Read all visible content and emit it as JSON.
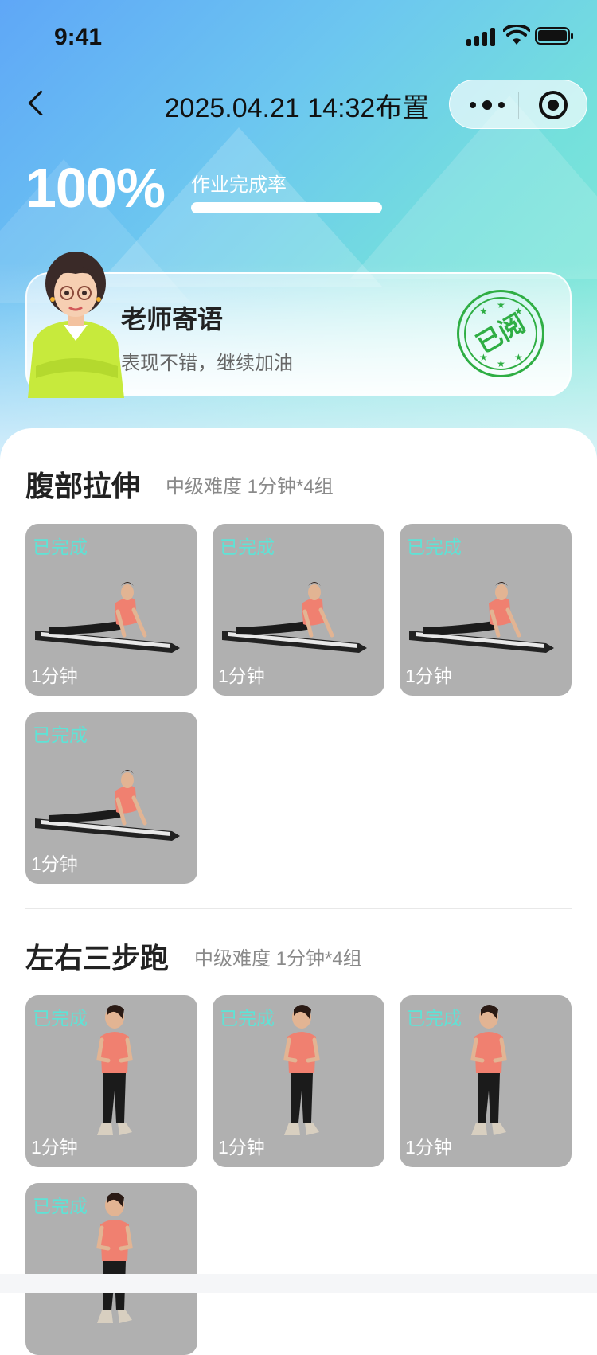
{
  "status": {
    "time": "9:41"
  },
  "nav": {
    "title": "2025.04.21 14:32布置"
  },
  "completion": {
    "rate_text": "100%",
    "label": "作业完成率",
    "fraction": 1.0
  },
  "teacher_note": {
    "title": "老师寄语",
    "message": "表现不错，继续加油",
    "stamp": "已阅"
  },
  "sections": [
    {
      "title": "腹部拉伸",
      "meta": "中级难度 1分钟*4组",
      "items": [
        {
          "status": "已完成",
          "duration": "1分钟"
        },
        {
          "status": "已完成",
          "duration": "1分钟"
        },
        {
          "status": "已完成",
          "duration": "1分钟"
        },
        {
          "status": "已完成",
          "duration": "1分钟"
        }
      ]
    },
    {
      "title": "左右三步跑",
      "meta": "中级难度 1分钟*4组",
      "items": [
        {
          "status": "已完成",
          "duration": "1分钟"
        },
        {
          "status": "已完成",
          "duration": "1分钟"
        },
        {
          "status": "已完成",
          "duration": "1分钟"
        },
        {
          "status": "已完成",
          "duration": ""
        }
      ]
    }
  ],
  "colors": {
    "done": "#5ee3d6",
    "stamp": "#2fae44",
    "tile_bg": "#b0b0b0"
  }
}
